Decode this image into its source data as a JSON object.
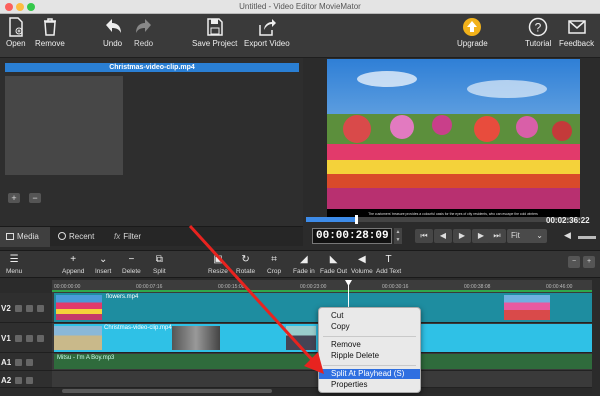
{
  "window": {
    "title": "Untitled - Video Editor MovieMator"
  },
  "toolbar": {
    "open": "Open",
    "remove": "Remove",
    "undo": "Undo",
    "redo": "Redo",
    "save_project": "Save Project",
    "export_video": "Export Video",
    "upgrade": "Upgrade",
    "tutorial": "Tutorial",
    "feedback": "Feedback"
  },
  "media_panel": {
    "selected_clip": "Christmas-video-clip.mp4",
    "add": "+",
    "remove": "−"
  },
  "tabs": [
    {
      "label": "Media",
      "icon": "media-icon"
    },
    {
      "label": "Recent",
      "icon": "clock-icon"
    },
    {
      "label": "Filter",
      "icon": "fx-icon",
      "prefix": "fx"
    }
  ],
  "preview": {
    "total_time": "00:02:36:22",
    "timecode": "00:00:28:09",
    "fit": "Fit",
    "caption": "The customers' treasure provides a colourful oasis for the eyes of city residents, who can escape the cold winters",
    "progress": 0.18
  },
  "timeline_tools": {
    "menu": "Menu",
    "append": "Append",
    "insert": "Insert",
    "delete": "Delete",
    "split": "Split",
    "resize": "Resize",
    "rotate": "Rotate",
    "crop": "Crop",
    "fade_in": "Fade in",
    "fade_out": "Fade Out",
    "volume": "Volume",
    "add_text": "Add Text"
  },
  "ruler": {
    "ticks": [
      "00:00:00:00",
      "00:00:07:16",
      "00:00:15:08",
      "00:00:23:00",
      "00:00:30:16",
      "00:00:38:08",
      "00:00:46:00"
    ]
  },
  "tracks": [
    {
      "label": "V2",
      "clip": "flowers.mp4"
    },
    {
      "label": "V1",
      "clip": "Christmas-video-clip.mp4"
    },
    {
      "label": "A1",
      "clip": "Mitsu - I'm A Boy.mp3"
    },
    {
      "label": "A2",
      "clip": ""
    }
  ],
  "context_menu": {
    "items": [
      "Cut",
      "Copy",
      "Remove",
      "Ripple Delete",
      "Split At Playhead (S)",
      "Properties"
    ],
    "selected": "Split At Playhead (S)"
  },
  "colors": {
    "accent": "#2f6fe0",
    "arrow": "#e8231f",
    "v1_clip": "#2fc1e6",
    "v2_clip": "#1e8da0",
    "audio_clip": "#2f6b3c"
  }
}
